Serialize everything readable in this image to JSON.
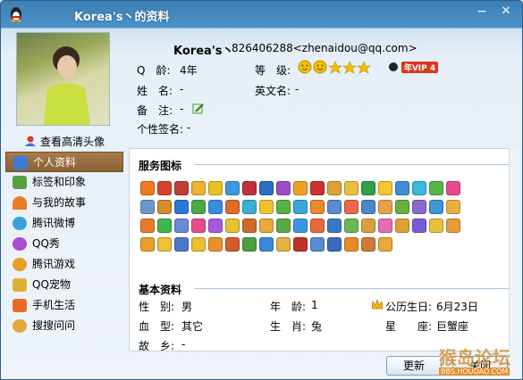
{
  "window": {
    "title": "Korea's丶的资料",
    "min_glyph": "−",
    "close_glyph": "✕"
  },
  "header": {
    "nickname": "Korea's丶",
    "qq_and_email": "826406288<zhenaidou@qq.com>"
  },
  "avatar": {
    "view_hd_label": "查看高清头像"
  },
  "profile": {
    "qage_label": "Q　龄:",
    "qage_value": "4年",
    "level_label": "等　级:",
    "vip_label": "年VIP 4",
    "name_label": "姓　名:",
    "name_value": "-",
    "english_name_label": "英文名:",
    "english_name_value": "-",
    "note_label": "备　注:",
    "note_value": "-",
    "signature_label": "个性签名:",
    "signature_value": "-"
  },
  "sidebar": {
    "items": [
      {
        "label": "个人资料",
        "icon": "profile-card-icon",
        "color": "#3a7bd5"
      },
      {
        "label": "标签和印象",
        "icon": "tag-icon",
        "color": "#56a042"
      },
      {
        "label": "与我的故事",
        "icon": "rainbow-icon",
        "color": "#e87c2b"
      },
      {
        "label": "腾讯微博",
        "icon": "weibo-icon",
        "color": "#3aa0d8"
      },
      {
        "label": "QQ秀",
        "icon": "qqshow-icon",
        "color": "#b04ad0"
      },
      {
        "label": "腾讯游戏",
        "icon": "game-icon",
        "color": "#e8a02a"
      },
      {
        "label": "QQ宠物",
        "icon": "pet-icon",
        "color": "#d9b338"
      },
      {
        "label": "手机生活",
        "icon": "mobile-icon",
        "color": "#e86a2a"
      },
      {
        "label": "搜搜问问",
        "icon": "question-icon",
        "color": "#e2a83a"
      }
    ]
  },
  "services": {
    "title": "服务图标",
    "colors": [
      [
        "#f07a1e",
        "#d9402a",
        "#c43d32",
        "#f0b030",
        "#e8c020",
        "#3a9ae0",
        "#c0303a",
        "#2a6ec8",
        "#a04ac8",
        "#f0a020",
        "#d03030",
        "#e0a030",
        "#e8c040",
        "#30a048",
        "#f5c530",
        "#3a8ed8",
        "#3ab8e0",
        "#52b848",
        "#e84a90"
      ],
      [
        "#6a98c8",
        "#d88a2a",
        "#2a78d8",
        "#4aa84a",
        "#3a8ae0",
        "#e06a2a",
        "#3ab0d0",
        "#f0c030",
        "#5ab040",
        "#38a8d8",
        "#e88a2a",
        "#5a8ad0",
        "#e86a4a",
        "#4a88c8",
        "#e8a04a",
        "#6ab040",
        "#8a6ad0",
        "#3a98d8",
        "#e8b040"
      ],
      [
        "#e87a2a",
        "#3ab848",
        "#6a8ad8",
        "#e84a8a",
        "#a85ad8",
        "#e8c030",
        "#d06a2a",
        "#e8a83a",
        "#5aa848",
        "#3a98e0",
        "#e86a3a",
        "#3a78c8",
        "#6ab850",
        "#d8a03a",
        "#e86ab0",
        "#e0a030",
        "#7a5ad8",
        "#e8c040",
        "#e89a3a"
      ],
      [
        "#e8a02a",
        "#f0c038",
        "#4a78c8",
        "#e8c030",
        "#e8902a",
        "#d85a2a",
        "#4aa040",
        "#3a88d8",
        "#e8b040",
        "#c0302a",
        "#5a8ad0",
        "#3a6ac0",
        "#e88a2a",
        "#d07a3a",
        "#e8a83a"
      ]
    ]
  },
  "basic": {
    "title": "基本资料",
    "gender_label": "性　别:",
    "gender_value": "男",
    "age_label": "年　龄:",
    "age_value": "1",
    "birthday_label": "公历生日:",
    "birthday_value": "6月23日",
    "blood_label": "血　型:",
    "blood_value": "其它",
    "zodiac_label": "生　肖:",
    "zodiac_value": "兔",
    "constellation_label": "星　　座:",
    "constellation_value": "巨蟹座",
    "hometown_label": "故　乡:",
    "hometown_value": "-"
  },
  "footer": {
    "refresh_label": "更新",
    "close_label": "关闭"
  },
  "watermark": {
    "text": "猴岛论坛",
    "url": "BBS.HOUDAO.COM"
  },
  "colors": {
    "title_bar": "#3d7fb5",
    "active_item": "#a87b4a",
    "section_line": "#a9c8e0"
  }
}
